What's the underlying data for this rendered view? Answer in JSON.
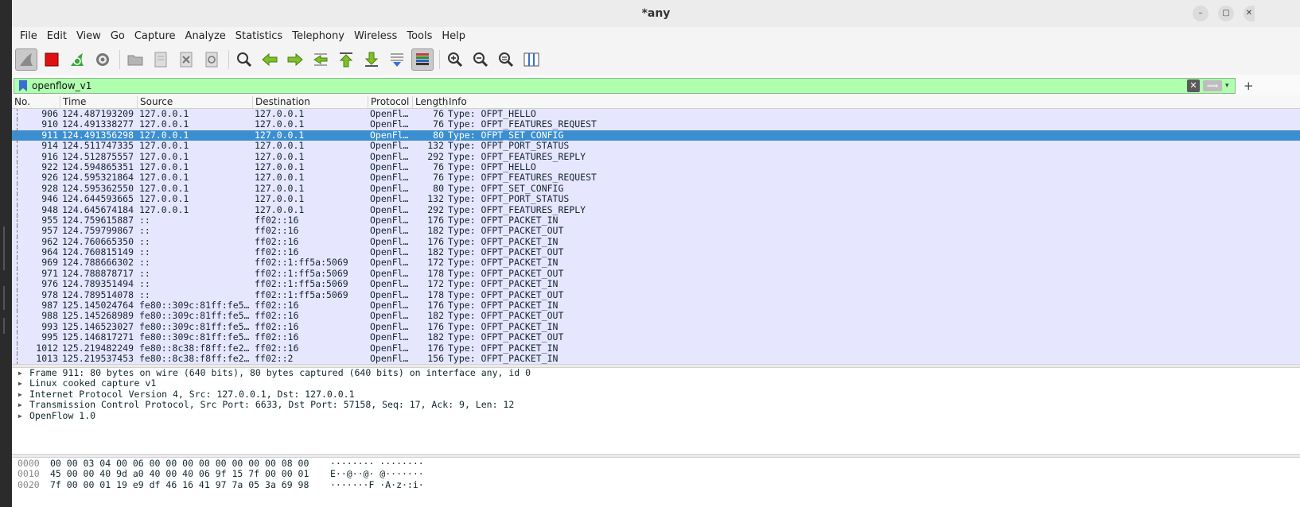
{
  "window": {
    "title": "*any",
    "minimize": "–",
    "maximize": "▢",
    "close": "✕"
  },
  "menu": [
    "File",
    "Edit",
    "View",
    "Go",
    "Capture",
    "Analyze",
    "Statistics",
    "Telephony",
    "Wireless",
    "Tools",
    "Help"
  ],
  "filter": {
    "value": "openflow_v1",
    "apply": "⟹",
    "dropdown": "▾",
    "add": "+",
    "clear": "✕"
  },
  "colors": {
    "filter_bg": "#afffaf",
    "row_bg": "#e7e6ff",
    "selected_bg": "#3b8fd0"
  },
  "columns": [
    "No.",
    "Time",
    "Source",
    "Destination",
    "Protocol",
    "Length",
    "Info"
  ],
  "packets": [
    {
      "no": "906",
      "time": "124.487193209",
      "src": "127.0.0.1",
      "dst": "127.0.0.1",
      "proto": "OpenFl…",
      "len": "76",
      "info": "Type: OFPT_HELLO"
    },
    {
      "no": "910",
      "time": "124.491338277",
      "src": "127.0.0.1",
      "dst": "127.0.0.1",
      "proto": "OpenFl…",
      "len": "76",
      "info": "Type: OFPT_FEATURES_REQUEST"
    },
    {
      "no": "911",
      "time": "124.491356298",
      "src": "127.0.0.1",
      "dst": "127.0.0.1",
      "proto": "OpenFl…",
      "len": "80",
      "info": "Type: OFPT_SET_CONFIG",
      "selected": true
    },
    {
      "no": "914",
      "time": "124.511747335",
      "src": "127.0.0.1",
      "dst": "127.0.0.1",
      "proto": "OpenFl…",
      "len": "132",
      "info": "Type: OFPT_PORT_STATUS"
    },
    {
      "no": "916",
      "time": "124.512875557",
      "src": "127.0.0.1",
      "dst": "127.0.0.1",
      "proto": "OpenFl…",
      "len": "292",
      "info": "Type: OFPT_FEATURES_REPLY"
    },
    {
      "no": "922",
      "time": "124.594865351",
      "src": "127.0.0.1",
      "dst": "127.0.0.1",
      "proto": "OpenFl…",
      "len": "76",
      "info": "Type: OFPT_HELLO"
    },
    {
      "no": "926",
      "time": "124.595321864",
      "src": "127.0.0.1",
      "dst": "127.0.0.1",
      "proto": "OpenFl…",
      "len": "76",
      "info": "Type: OFPT_FEATURES_REQUEST"
    },
    {
      "no": "928",
      "time": "124.595362550",
      "src": "127.0.0.1",
      "dst": "127.0.0.1",
      "proto": "OpenFl…",
      "len": "80",
      "info": "Type: OFPT_SET_CONFIG"
    },
    {
      "no": "946",
      "time": "124.644593665",
      "src": "127.0.0.1",
      "dst": "127.0.0.1",
      "proto": "OpenFl…",
      "len": "132",
      "info": "Type: OFPT_PORT_STATUS"
    },
    {
      "no": "948",
      "time": "124.645674184",
      "src": "127.0.0.1",
      "dst": "127.0.0.1",
      "proto": "OpenFl…",
      "len": "292",
      "info": "Type: OFPT_FEATURES_REPLY"
    },
    {
      "no": "955",
      "time": "124.759615887",
      "src": "::",
      "dst": "ff02::16",
      "proto": "OpenFl…",
      "len": "176",
      "info": "Type: OFPT_PACKET_IN"
    },
    {
      "no": "957",
      "time": "124.759799867",
      "src": "::",
      "dst": "ff02::16",
      "proto": "OpenFl…",
      "len": "182",
      "info": "Type: OFPT_PACKET_OUT"
    },
    {
      "no": "962",
      "time": "124.760665350",
      "src": "::",
      "dst": "ff02::16",
      "proto": "OpenFl…",
      "len": "176",
      "info": "Type: OFPT_PACKET_IN"
    },
    {
      "no": "964",
      "time": "124.760815149",
      "src": "::",
      "dst": "ff02::16",
      "proto": "OpenFl…",
      "len": "182",
      "info": "Type: OFPT_PACKET_OUT"
    },
    {
      "no": "969",
      "time": "124.788666302",
      "src": "::",
      "dst": "ff02::1:ff5a:5069",
      "proto": "OpenFl…",
      "len": "172",
      "info": "Type: OFPT_PACKET_IN"
    },
    {
      "no": "971",
      "time": "124.788878717",
      "src": "::",
      "dst": "ff02::1:ff5a:5069",
      "proto": "OpenFl…",
      "len": "178",
      "info": "Type: OFPT_PACKET_OUT"
    },
    {
      "no": "976",
      "time": "124.789351494",
      "src": "::",
      "dst": "ff02::1:ff5a:5069",
      "proto": "OpenFl…",
      "len": "172",
      "info": "Type: OFPT_PACKET_IN"
    },
    {
      "no": "978",
      "time": "124.789514078",
      "src": "::",
      "dst": "ff02::1:ff5a:5069",
      "proto": "OpenFl…",
      "len": "178",
      "info": "Type: OFPT_PACKET_OUT"
    },
    {
      "no": "987",
      "time": "125.145024764",
      "src": "fe80::309c:81ff:fe5…",
      "dst": "ff02::16",
      "proto": "OpenFl…",
      "len": "176",
      "info": "Type: OFPT_PACKET_IN"
    },
    {
      "no": "988",
      "time": "125.145268989",
      "src": "fe80::309c:81ff:fe5…",
      "dst": "ff02::16",
      "proto": "OpenFl…",
      "len": "182",
      "info": "Type: OFPT_PACKET_OUT"
    },
    {
      "no": "993",
      "time": "125.146523027",
      "src": "fe80::309c:81ff:fe5…",
      "dst": "ff02::16",
      "proto": "OpenFl…",
      "len": "176",
      "info": "Type: OFPT_PACKET_IN"
    },
    {
      "no": "995",
      "time": "125.146817271",
      "src": "fe80::309c:81ff:fe5…",
      "dst": "ff02::16",
      "proto": "OpenFl…",
      "len": "182",
      "info": "Type: OFPT_PACKET_OUT"
    },
    {
      "no": "1012",
      "time": "125.219482249",
      "src": "fe80::8c38:f8ff:fe2…",
      "dst": "ff02::16",
      "proto": "OpenFl…",
      "len": "176",
      "info": "Type: OFPT_PACKET_IN"
    },
    {
      "no": "1013",
      "time": "125.219537453",
      "src": "fe80::8c38:f8ff:fe2…",
      "dst": "ff02::2",
      "proto": "OpenFl…",
      "len": "156",
      "info": "Type: OFPT_PACKET_IN"
    }
  ],
  "details": [
    "Frame 911: 80 bytes on wire (640 bits), 80 bytes captured (640 bits) on interface any, id 0",
    "Linux cooked capture v1",
    "Internet Protocol Version 4, Src: 127.0.0.1, Dst: 127.0.0.1",
    "Transmission Control Protocol, Src Port: 6633, Dst Port: 57158, Seq: 17, Ack: 9, Len: 12",
    "OpenFlow 1.0"
  ],
  "bytes": [
    {
      "offset": "0000",
      "hex": "00 00 03 04 00 06 00 00  00 00 00 00 00 00 08 00",
      "ascii": "········ ········"
    },
    {
      "offset": "0010",
      "hex": "45 00 00 40 9d a0 40 00  40 06 9f 15 7f 00 00 01",
      "ascii": "E··@··@· @·······"
    },
    {
      "offset": "0020",
      "hex": "7f 00 00 01 19 e9 df 46  16 41 97 7a 05 3a 69 98",
      "ascii": "·······F ·A·z·:i·"
    }
  ]
}
